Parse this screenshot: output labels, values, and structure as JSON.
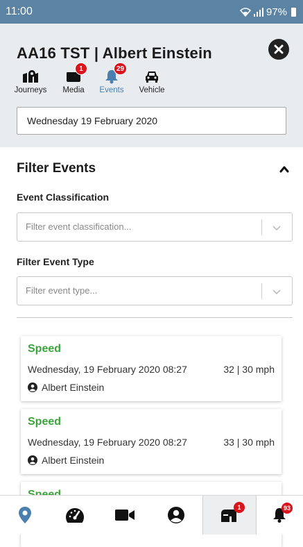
{
  "status_bar": {
    "time": "11:00",
    "battery": "97%"
  },
  "header": {
    "title": "AA16 TST | Albert Einstein",
    "tabs": [
      {
        "label": "Journeys",
        "icon": "map-marker-icon",
        "badge": ""
      },
      {
        "label": "Media",
        "icon": "media-icon",
        "badge": "1"
      },
      {
        "label": "Events",
        "icon": "bell-icon",
        "badge": "29",
        "active": true
      },
      {
        "label": "Vehicle",
        "icon": "car-icon",
        "badge": ""
      }
    ],
    "date": "Wednesday 19 February 2020"
  },
  "filter": {
    "title": "Filter Events",
    "classification_label": "Event Classification",
    "classification_placeholder": "Filter event classification...",
    "type_label": "Filter Event Type",
    "type_placeholder": "Filter event type..."
  },
  "events": [
    {
      "type": "Speed",
      "datetime": "Wednesday, 19 February 2020 08:27",
      "speed": "32 | 30 mph",
      "driver": "Albert Einstein"
    },
    {
      "type": "Speed",
      "datetime": "Wednesday, 19 February 2020 08:27",
      "speed": "33 | 30 mph",
      "driver": "Albert Einstein"
    },
    {
      "type": "Speed"
    }
  ],
  "bottom_nav": {
    "items": [
      {
        "icon": "location-pin-icon"
      },
      {
        "icon": "speedometer-icon"
      },
      {
        "icon": "video-camera-icon"
      },
      {
        "icon": "user-circle-icon"
      },
      {
        "icon": "mailbox-icon",
        "badge": "1",
        "active": true
      },
      {
        "icon": "bell-icon",
        "badge": "93"
      }
    ]
  },
  "colors": {
    "status_bar": "#5b83a3",
    "header_bg": "#e9ecef",
    "accent_blue": "#4a7fb0",
    "event_green": "#3aa53a",
    "badge_red": "#d8141c"
  }
}
